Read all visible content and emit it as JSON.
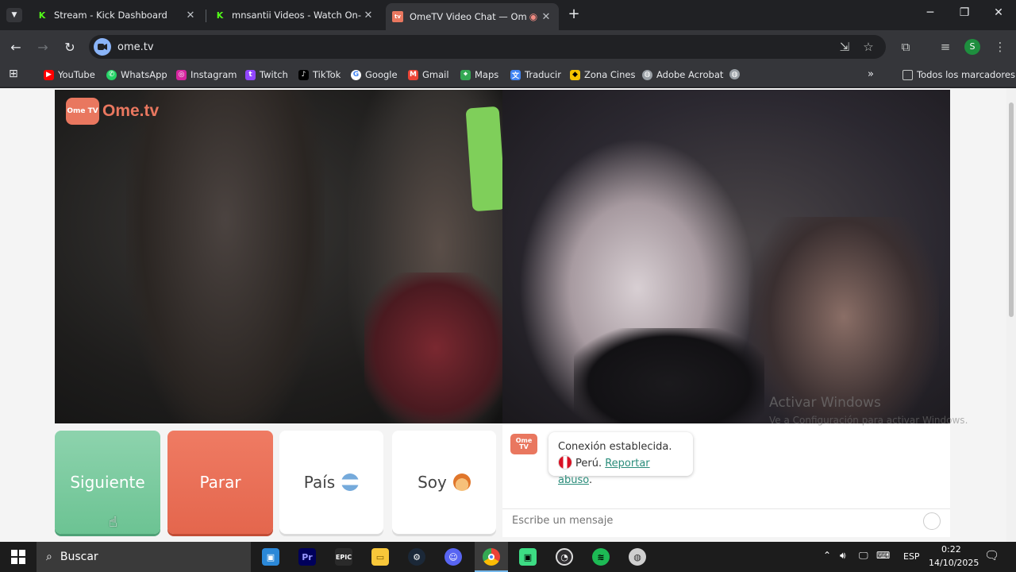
{
  "browser": {
    "tabs": [
      {
        "title": "Stream - Kick Dashboard",
        "favicon": "kick-icon",
        "active": false
      },
      {
        "title": "mnsantii Videos - Watch On-De",
        "favicon": "kick-icon",
        "active": false
      },
      {
        "title": "OmeTV Video Chat — Ome",
        "favicon": "ometv-icon",
        "active": true
      }
    ],
    "new_tab": "+",
    "url": "ome.tv",
    "profile_initial": "S",
    "bookmarks": [
      {
        "label": "YouTube",
        "icon": "youtube-icon",
        "color": "#ff0000"
      },
      {
        "label": "WhatsApp",
        "icon": "whatsapp-icon",
        "color": "#25d366"
      },
      {
        "label": "Instagram",
        "icon": "instagram-icon",
        "color": "#d6249f"
      },
      {
        "label": "Twitch",
        "icon": "twitch-icon",
        "color": "#9146ff"
      },
      {
        "label": "TikTok",
        "icon": "tiktok-icon",
        "color": "#000000"
      },
      {
        "label": "Google",
        "icon": "google-icon",
        "color": "#4285f4"
      },
      {
        "label": "Gmail",
        "icon": "gmail-icon",
        "color": "#ea4335"
      },
      {
        "label": "Maps",
        "icon": "maps-icon",
        "color": "#34a853"
      },
      {
        "label": "Traducir",
        "icon": "translate-icon",
        "color": "#4285f4"
      },
      {
        "label": "Zona Cines",
        "icon": "cinema-icon",
        "color": "#f5c400"
      },
      {
        "label": "Adobe Acrobat",
        "icon": "globe-icon",
        "color": "#9aa0a6"
      }
    ],
    "all_bookmarks": "Todos los marcadores"
  },
  "page": {
    "logo_text": "Ome.tv",
    "logo_badge": "Ome TV",
    "buttons": {
      "next": "Siguiente",
      "stop": "Parar",
      "country": "País",
      "gender": "Soy"
    },
    "chat": {
      "status": "Conexión establecida.",
      "country": "Perú.",
      "report": "Reportar abuso",
      "report_suffix": ".",
      "placeholder": "Escribe un mensaje"
    }
  },
  "watermark": {
    "title": "Activar Windows",
    "subtitle": "Ve a Configuración para activar Windows."
  },
  "taskbar": {
    "search_label": "Buscar",
    "language": "ESP",
    "time": "0:22",
    "date": "14/10/2025"
  }
}
